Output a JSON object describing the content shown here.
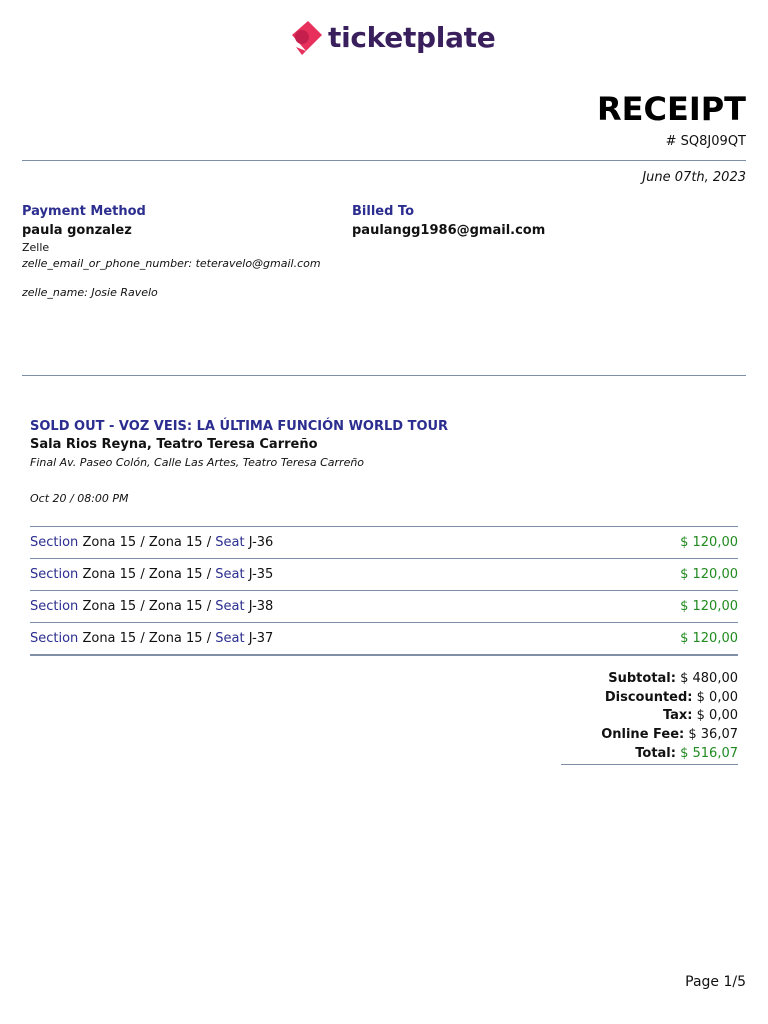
{
  "brand": {
    "name": "ticketplate",
    "logo_color": "#e8305c",
    "text_color": "#3a1f5d"
  },
  "receipt": {
    "title": "RECEIPT",
    "number": "# SQ8J09QT",
    "date": "June 07th, 2023"
  },
  "payment": {
    "heading": "Payment Method",
    "name": "paula gonzalez",
    "method": "Zelle",
    "detail1": "zelle_email_or_phone_number: teteravelo@gmail.com",
    "detail2": "zelle_name: Josie Ravelo"
  },
  "billed": {
    "heading": "Billed To",
    "email": "paulangg1986@gmail.com"
  },
  "event": {
    "title": "SOLD OUT - VOZ VEIS: LA ÚLTIMA FUNCIÓN WORLD TOUR",
    "venue": "Sala Rios Reyna, Teatro Teresa Carreño",
    "address": "Final Av. Paseo Colón, Calle Las Artes, Teatro Teresa Carreño",
    "datetime": "Oct 20 / 08:00 PM"
  },
  "tickets": [
    {
      "section_label": "Section",
      "section": "Zona 15 / Zona 15 /",
      "seat_label": "Seat",
      "seat": "J-36",
      "price": "$ 120,00"
    },
    {
      "section_label": "Section",
      "section": "Zona 15 / Zona 15 /",
      "seat_label": "Seat",
      "seat": "J-35",
      "price": "$ 120,00"
    },
    {
      "section_label": "Section",
      "section": "Zona 15 / Zona 15 /",
      "seat_label": "Seat",
      "seat": "J-38",
      "price": "$ 120,00"
    },
    {
      "section_label": "Section",
      "section": "Zona 15 / Zona 15 /",
      "seat_label": "Seat",
      "seat": "J-37",
      "price": "$ 120,00"
    }
  ],
  "totals": {
    "subtotal_label": "Subtotal:",
    "subtotal": "$ 480,00",
    "discount_label": "Discounted:",
    "discount": "$ 0,00",
    "tax_label": "Tax:",
    "tax": "$ 0,00",
    "fee_label": "Online Fee:",
    "fee": "$ 36,07",
    "total_label": "Total:",
    "total": "$ 516,07"
  },
  "footer": {
    "page": "Page 1/5"
  },
  "colors": {
    "accent": "#2b2d8f",
    "price": "#1f8a1f",
    "rule": "#7f8fa8"
  }
}
